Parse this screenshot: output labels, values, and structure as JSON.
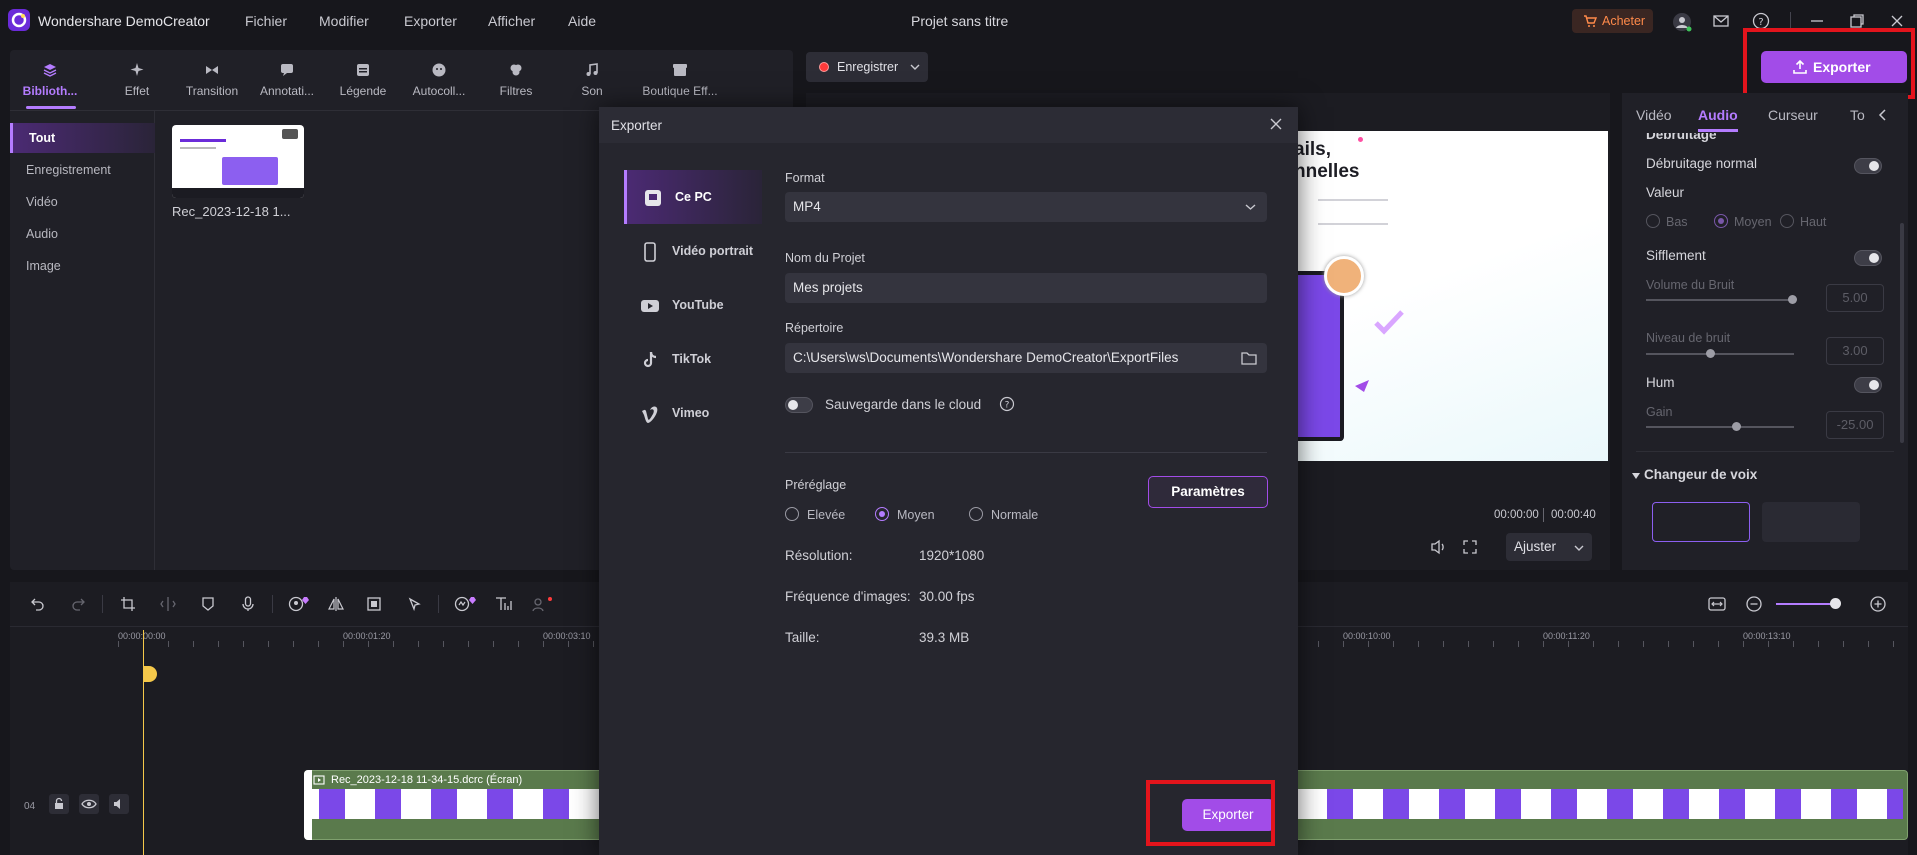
{
  "app": {
    "name": "Wondershare DemoCreator",
    "project_title": "Projet sans titre",
    "menu": [
      "Fichier",
      "Modifier",
      "Exporter",
      "Afficher",
      "Aide"
    ],
    "buy_label": "Acheter"
  },
  "toolbar_tabs": [
    "Biblioth...",
    "Effet",
    "Transition",
    "Annotati...",
    "Légende",
    "Autocoll...",
    "Filtres",
    "Son",
    "Boutique Eff..."
  ],
  "library": {
    "sidebar": [
      "Tout",
      "Enregistrement",
      "Vidéo",
      "Audio",
      "Image"
    ],
    "clip_name": "Rec_2023-12-18 1..."
  },
  "record_button": "Enregistrer",
  "export_top_label": "Exporter",
  "preview": {
    "heading_line1": "ails,",
    "heading_line2": "nnelles",
    "time_current": "00:00:00",
    "time_total": "00:00:40",
    "fit_label": "Ajuster"
  },
  "props": {
    "tabs": [
      "Vidéo",
      "Audio",
      "Curseur",
      "To"
    ],
    "partial_header": "Débruitage",
    "denoise_label": "Débruitage normal",
    "value_label": "Valeur",
    "value_options": [
      "Bas",
      "Moyen",
      "Haut"
    ],
    "whistle_label": "Sifflement",
    "noise_volume_label": "Volume du Bruit",
    "noise_volume_value": "5.00",
    "noise_level_label": "Niveau de bruit",
    "noise_level_value": "3.00",
    "hum_label": "Hum",
    "gain_label": "Gain",
    "gain_value": "-25.00",
    "voice_changer_label": "Changeur de voix"
  },
  "timeline": {
    "ruler_left": [
      "00:00:00:00",
      "00:00:01:20",
      "00:00:03:10"
    ],
    "ruler_right": [
      "00:00:10:00",
      "00:00:11:20",
      "00:00:13:10"
    ],
    "track_number": "04",
    "clip_label": "Rec_2023-12-18 11-34-15.dcrc (Écran)"
  },
  "export_dialog": {
    "title": "Exporter",
    "destinations": [
      "Ce PC",
      "Vidéo portrait",
      "YouTube",
      "TikTok",
      "Vimeo"
    ],
    "format_label": "Format",
    "format_value": "MP4",
    "project_name_label": "Nom du Projet",
    "project_name_value": "Mes projets",
    "directory_label": "Répertoire",
    "directory_value": "C:\\Users\\ws\\Documents\\Wondershare DemoCreator\\ExportFiles",
    "cloud_label": "Sauvegarde dans le cloud",
    "preset_label": "Préréglage",
    "preset_options": [
      "Elevée",
      "Moyen",
      "Normale"
    ],
    "settings_button": "Paramètres",
    "resolution_label": "Résolution:",
    "resolution_value": "1920*1080",
    "framerate_label": "Fréquence d'images:",
    "framerate_value": "30.00 fps",
    "size_label": "Taille:",
    "size_value": "39.3 MB",
    "export_button": "Exporter"
  },
  "colors": {
    "accent": "#a24ce8",
    "highlight": "#e3141c"
  }
}
